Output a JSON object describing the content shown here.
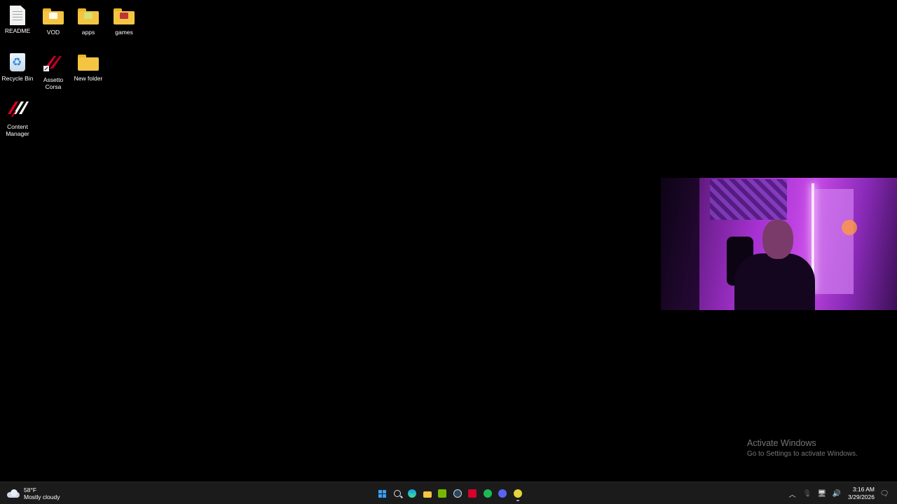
{
  "desktop": {
    "icons": [
      {
        "label": "README",
        "type": "document"
      },
      {
        "label": "VOD",
        "type": "folder"
      },
      {
        "label": "apps",
        "type": "folder"
      },
      {
        "label": "games",
        "type": "folder"
      },
      {
        "label": "Recycle Bin",
        "type": "recycle-bin"
      },
      {
        "label": "Assetto Corsa",
        "type": "shortcut"
      },
      {
        "label": "New folder",
        "type": "folder"
      },
      {
        "label": "Content Manager",
        "type": "app"
      }
    ]
  },
  "watermark": {
    "title": "Activate Windows",
    "subtitle": "Go to Settings to activate Windows."
  },
  "taskbar": {
    "weather": {
      "temp": "58°F",
      "condition": "Mostly cloudy"
    },
    "apps": [
      {
        "name": "start-button-icon",
        "color": "#3aa0ff"
      },
      {
        "name": "search-icon"
      },
      {
        "name": "edge-icon",
        "color": "#1f9cf0"
      },
      {
        "name": "file-explorer-icon",
        "color": "#f4c542"
      },
      {
        "name": "nvidia-icon",
        "color": "#76b900"
      },
      {
        "name": "steam-icon",
        "color": "#c7d5e0"
      },
      {
        "name": "assetto-corsa-icon",
        "color": "#d6002a"
      },
      {
        "name": "spotify-icon",
        "color": "#1db954"
      },
      {
        "name": "discord-icon",
        "color": "#5865f2"
      },
      {
        "name": "obs-icon",
        "color": "#e6d43a"
      }
    ],
    "clock": {
      "time": "3:16 AM",
      "date": "3/29/2026"
    }
  }
}
